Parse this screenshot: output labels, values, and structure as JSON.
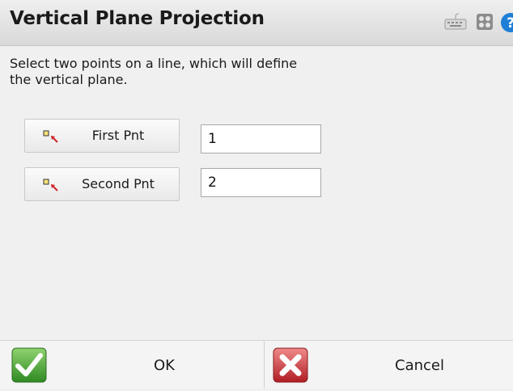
{
  "window": {
    "title": "Vertical Plane Projection",
    "icons": [
      "keyboard-icon",
      "grid-icon",
      "help-icon"
    ]
  },
  "main": {
    "instructions": "Select two points on a line, which will define the vertical plane.",
    "first_point": {
      "button_label": "First Pnt",
      "value": "1",
      "icon": "pick-point-icon"
    },
    "second_point": {
      "button_label": "Second Pnt",
      "value": "2",
      "icon": "pick-point-icon"
    }
  },
  "footer": {
    "ok_label": "OK",
    "cancel_label": "Cancel",
    "ok_icon": "green-checkmark-icon",
    "cancel_icon": "red-x-icon"
  },
  "colors": {
    "ok_green": "#3d9a2e",
    "cancel_red": "#c0282d",
    "selection_blue": "#3a78c8",
    "help_blue": "#1f7fd6"
  }
}
